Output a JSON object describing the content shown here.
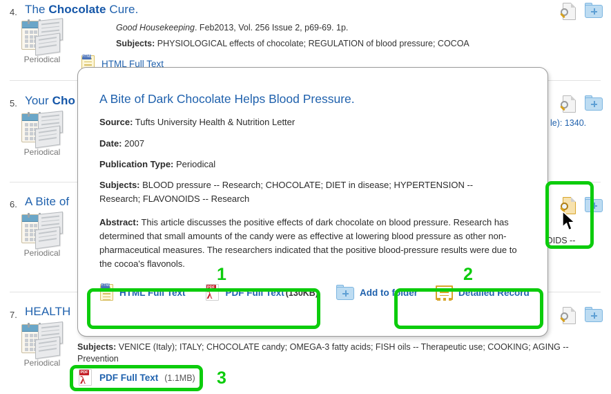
{
  "results": [
    {
      "number": "4.",
      "title_pre": "The ",
      "title_bold": "Chocolate",
      "title_post": " Cure.",
      "doc_type": "Periodical",
      "meta_italic": "Good Housekeeping",
      "meta_rest": ". Feb2013, Vol. 256 Issue 2, p69-69. 1p.",
      "subjects_label": "Subjects:",
      "subjects_text": " PHYSIOLOGICAL effects of chocolate; REGULATION of blood pressure; COCOA",
      "fulltext_label": "HTML Full Text"
    },
    {
      "number": "5.",
      "title_pre": "Your ",
      "title_bold": "Cho",
      "title_post": "",
      "doc_type": "Periodical",
      "tail_text": "le): 1340."
    },
    {
      "number": "6.",
      "title_pre": "A Bite of ",
      "title_bold": "",
      "title_post": "",
      "doc_type": "Periodical",
      "tail_text": "OIDS --"
    },
    {
      "number": "7.",
      "title_pre": "HEALTH",
      "title_bold": "",
      "title_post": "",
      "doc_type": "Periodical",
      "subjects_label": "Subjects:",
      "subjects_text": " VENICE (Italy); ITALY; CHOCOLATE candy; OMEGA-3 fatty acids; FISH oils -- Therapeutic use; COOKING; AGING -- Prevention",
      "pdf_label": "PDF Full Text",
      "pdf_size": "(1.1MB)"
    }
  ],
  "popup": {
    "title": "A Bite of Dark Chocolate Helps Blood Pressure.",
    "fields": [
      {
        "label": "Source:",
        "value": "Tufts University Health & Nutrition Letter"
      },
      {
        "label": "Date:",
        "value": "2007"
      },
      {
        "label": "Publication Type:",
        "value": "Periodical"
      }
    ],
    "subjects_label": "Subjects:",
    "subjects_value": "BLOOD pressure -- Research; CHOCOLATE; DIET in disease; HYPERTENSION -- Research; FLAVONOIDS -- Research",
    "abstract_label": "Abstract:",
    "abstract_value": "This article discusses the positive effects of dark chocolate on blood pressure. Research has determined that small amounts of the candy were as effective at lowering blood pressure as other non-pharmaceutical measures. The researchers indicated that the positive blood-pressure results were due to the cocoa's flavonols.",
    "toolbar": {
      "html_full_text": "HTML Full Text",
      "pdf_full_text": "PDF Full Text",
      "pdf_size": "(130KB)",
      "add_to_folder": "Add to folder",
      "detailed_record": "Detailed Record"
    }
  },
  "annotations": {
    "accent_color": "#0ccc0c",
    "numbers": [
      "1",
      "2",
      "3"
    ]
  },
  "icons": {
    "preview": "preview-magnifier-icon",
    "add_folder": "add-to-folder-icon",
    "html": "html-document-icon",
    "pdf": "pdf-document-icon",
    "record": "detailed-record-icon",
    "periodical": "periodical-icon",
    "cursor": "mouse-cursor-icon"
  }
}
